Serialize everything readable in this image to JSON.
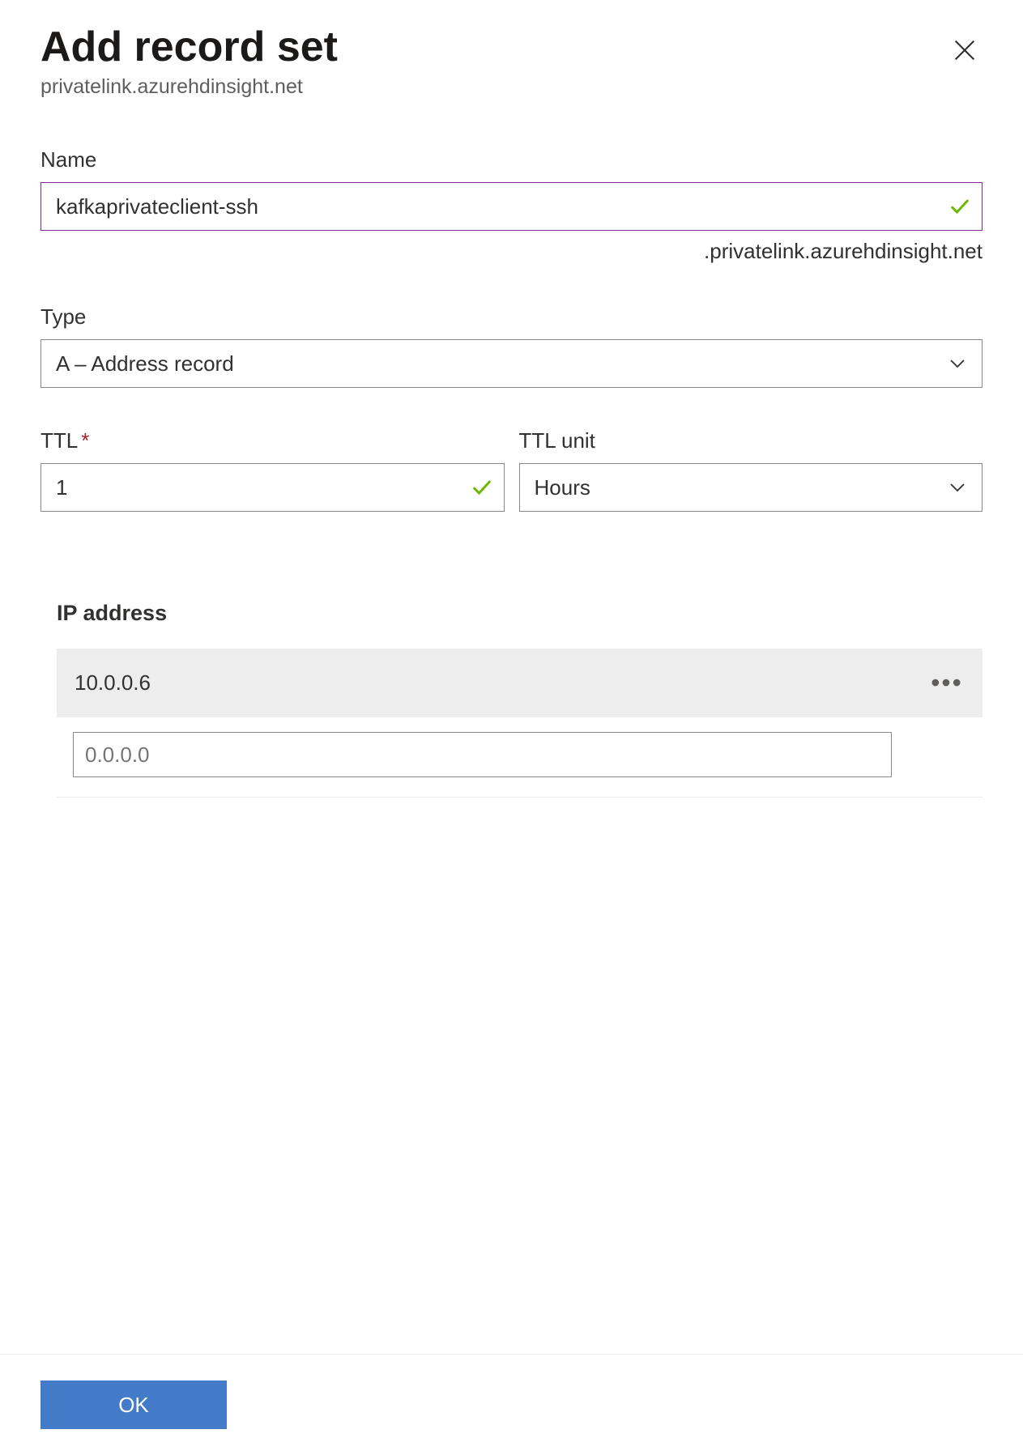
{
  "header": {
    "title": "Add record set",
    "subtitle": "privatelink.azurehdinsight.net"
  },
  "fields": {
    "name": {
      "label": "Name",
      "value": "kafkaprivateclient-ssh",
      "suffix": ".privatelink.azurehdinsight.net"
    },
    "type": {
      "label": "Type",
      "value": "A – Address record"
    },
    "ttl": {
      "label": "TTL",
      "value": "1"
    },
    "ttl_unit": {
      "label": "TTL unit",
      "value": "Hours"
    }
  },
  "ip": {
    "header": "IP address",
    "rows": [
      "10.0.0.6"
    ],
    "new_placeholder": "0.0.0.0"
  },
  "footer": {
    "ok": "OK"
  }
}
